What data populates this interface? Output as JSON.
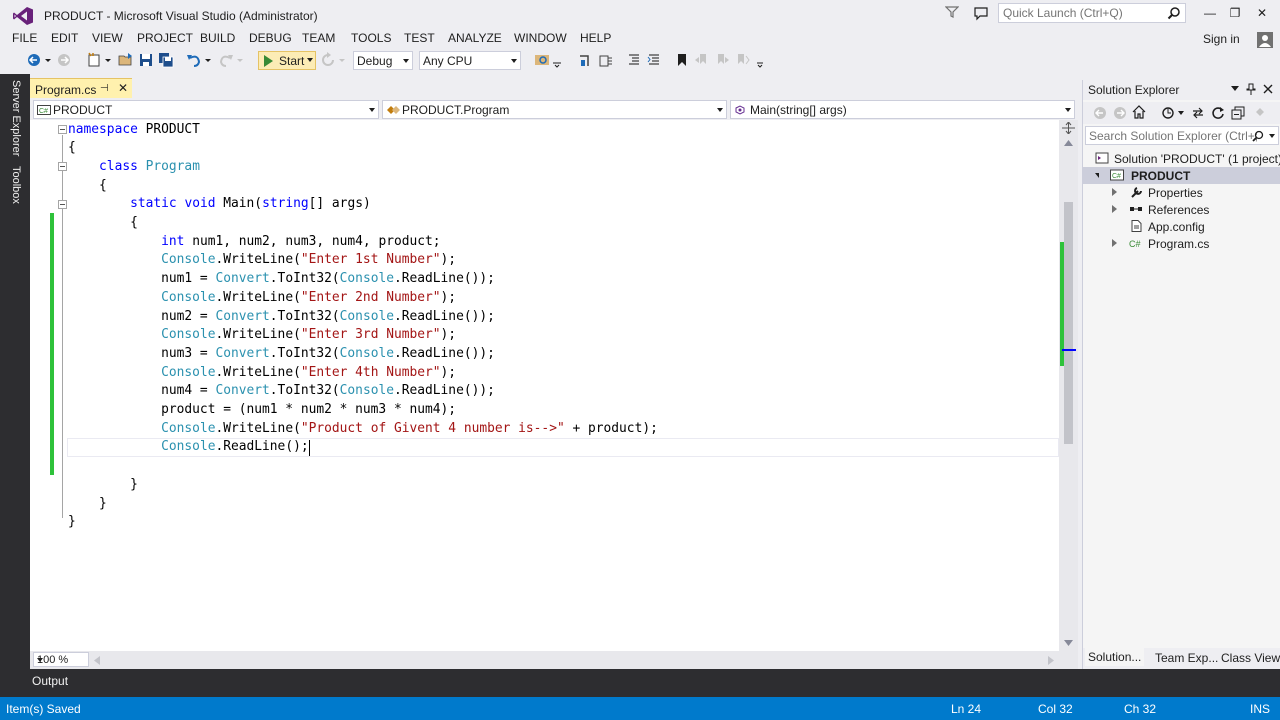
{
  "window": {
    "title": "PRODUCT - Microsoft Visual Studio (Administrator)",
    "quick_launch_placeholder": "Quick Launch (Ctrl+Q)",
    "minimize": "—",
    "restore": "❐",
    "close": "✕"
  },
  "menu": {
    "items": [
      "FILE",
      "EDIT",
      "VIEW",
      "PROJECT",
      "BUILD",
      "DEBUG",
      "TEAM",
      "TOOLS",
      "TEST",
      "ANALYZE",
      "WINDOW",
      "HELP"
    ],
    "signin": "Sign in"
  },
  "toolbar": {
    "start_label": "Start",
    "config": "Debug",
    "platform": "Any CPU"
  },
  "left_strip": {
    "tabs": [
      "Server Explorer",
      "Toolbox"
    ]
  },
  "document_tab": {
    "label": "Program.cs",
    "pin": "⊣",
    "close": "✕"
  },
  "navigation_bar": {
    "project": "PRODUCT",
    "type": "PRODUCT.Program",
    "member": "Main(string[] args)"
  },
  "code_lines": [
    [
      [
        "namespace",
        "kw"
      ],
      [
        " PRODUCT",
        ""
      ]
    ],
    [
      [
        "{",
        ""
      ]
    ],
    [
      [
        "    ",
        ""
      ],
      [
        "class",
        "kw"
      ],
      [
        " ",
        ""
      ],
      [
        "Program",
        "ty"
      ]
    ],
    [
      [
        "    {",
        ""
      ]
    ],
    [
      [
        "        ",
        ""
      ],
      [
        "static",
        "kw"
      ],
      [
        " ",
        ""
      ],
      [
        "void",
        "kw"
      ],
      [
        " Main(",
        ""
      ],
      [
        "string",
        "kw"
      ],
      [
        "[] args)",
        ""
      ]
    ],
    [
      [
        "        {",
        ""
      ]
    ],
    [
      [
        "            ",
        ""
      ],
      [
        "int",
        "kw"
      ],
      [
        " num1, num2, num3, num4, product;",
        ""
      ]
    ],
    [
      [
        "            ",
        ""
      ],
      [
        "Console",
        "ty"
      ],
      [
        ".WriteLine(",
        ""
      ],
      [
        "\"Enter 1st Number\"",
        "st"
      ],
      [
        ");",
        ""
      ]
    ],
    [
      [
        "            num1 = ",
        ""
      ],
      [
        "Convert",
        "ty"
      ],
      [
        ".ToInt32(",
        ""
      ],
      [
        "Console",
        "ty"
      ],
      [
        ".ReadLine());",
        ""
      ]
    ],
    [
      [
        "            ",
        ""
      ],
      [
        "Console",
        "ty"
      ],
      [
        ".WriteLine(",
        ""
      ],
      [
        "\"Enter 2nd Number\"",
        "st"
      ],
      [
        ");",
        ""
      ]
    ],
    [
      [
        "            num2 = ",
        ""
      ],
      [
        "Convert",
        "ty"
      ],
      [
        ".ToInt32(",
        ""
      ],
      [
        "Console",
        "ty"
      ],
      [
        ".ReadLine());",
        ""
      ]
    ],
    [
      [
        "            ",
        ""
      ],
      [
        "Console",
        "ty"
      ],
      [
        ".WriteLine(",
        ""
      ],
      [
        "\"Enter 3rd Number\"",
        "st"
      ],
      [
        ");",
        ""
      ]
    ],
    [
      [
        "            num3 = ",
        ""
      ],
      [
        "Convert",
        "ty"
      ],
      [
        ".ToInt32(",
        ""
      ],
      [
        "Console",
        "ty"
      ],
      [
        ".ReadLine());",
        ""
      ]
    ],
    [
      [
        "            ",
        ""
      ],
      [
        "Console",
        "ty"
      ],
      [
        ".WriteLine(",
        ""
      ],
      [
        "\"Enter 4th Number\"",
        "st"
      ],
      [
        ");",
        ""
      ]
    ],
    [
      [
        "            num4 = ",
        ""
      ],
      [
        "Convert",
        "ty"
      ],
      [
        ".ToInt32(",
        ""
      ],
      [
        "Console",
        "ty"
      ],
      [
        ".ReadLine());",
        ""
      ]
    ],
    [
      [
        "            product = (num1 * num2 * num3 * num4);",
        ""
      ]
    ],
    [
      [
        "            ",
        ""
      ],
      [
        "Console",
        "ty"
      ],
      [
        ".WriteLine(",
        ""
      ],
      [
        "\"Product of Givent 4 number is-->\"",
        "st"
      ],
      [
        " + product);",
        ""
      ]
    ],
    [
      [
        "            ",
        ""
      ],
      [
        "Console",
        "ty"
      ],
      [
        ".ReadLine();",
        ""
      ]
    ],
    [
      [
        "",
        ""
      ]
    ],
    [
      [
        "        }",
        ""
      ]
    ],
    [
      [
        "    }",
        ""
      ]
    ],
    [
      [
        "}",
        ""
      ]
    ]
  ],
  "zoom": "100 %",
  "solution_explorer": {
    "title": "Solution Explorer",
    "search_placeholder": "Search Solution Explorer (Ctrl+;)",
    "tree": [
      {
        "label": "Solution 'PRODUCT' (1 project)",
        "icon": "solution-icon",
        "expander": "none"
      },
      {
        "label": "PRODUCT",
        "icon": "csharp-project-icon",
        "expander": "down",
        "bold": true
      },
      {
        "label": "Properties",
        "icon": "wrench-icon",
        "expander": "right"
      },
      {
        "label": "References",
        "icon": "references-icon",
        "expander": "right"
      },
      {
        "label": "App.config",
        "icon": "config-file-icon",
        "expander": "none"
      },
      {
        "label": "Program.cs",
        "icon": "csharp-file-icon",
        "expander": "right"
      }
    ],
    "tabs": [
      "Solution...",
      "Team Exp...",
      "Class View"
    ]
  },
  "output": {
    "label": "Output"
  },
  "status": {
    "message": "Item(s) Saved",
    "line": "Ln 24",
    "col": "Col 32",
    "ch": "Ch 32",
    "mode": "INS"
  },
  "colors": {
    "status_bar": "#007acc",
    "tab_active": "#fff1ae",
    "keyword": "#0000ff",
    "type": "#2b91af",
    "string": "#a31515",
    "change_margin": "#2ec23a"
  }
}
